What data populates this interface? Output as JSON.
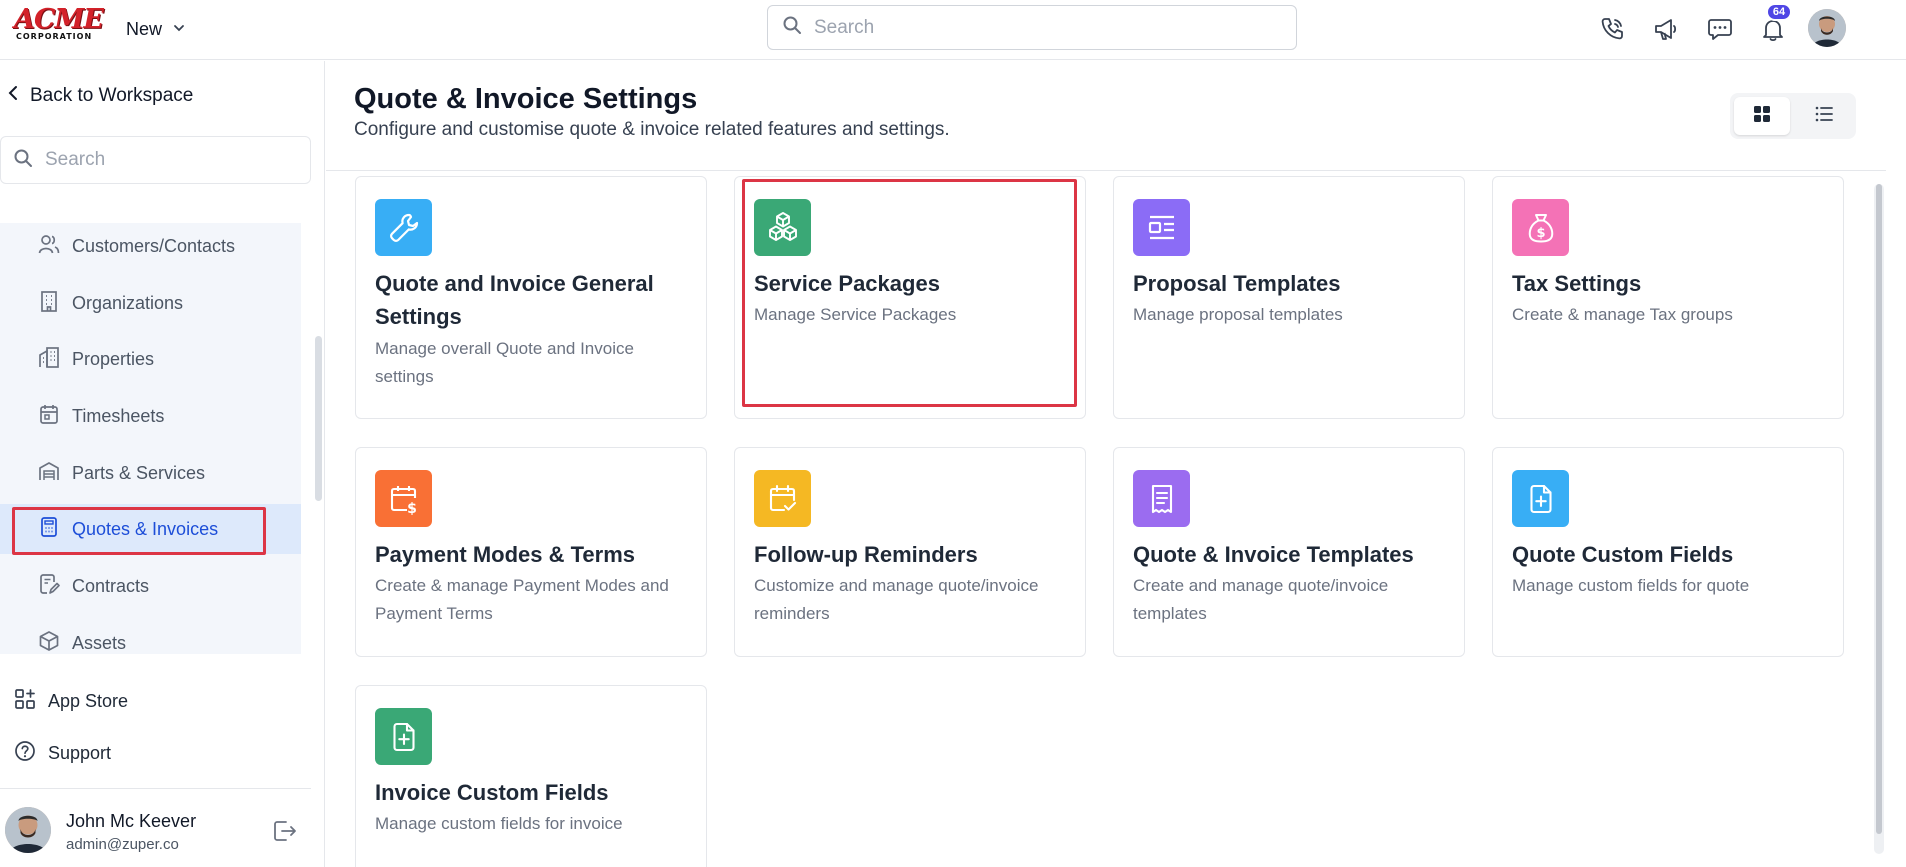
{
  "brand": {
    "logo_main": "ACME",
    "logo_sub": "CORPORATION"
  },
  "topbar": {
    "new_label": "New",
    "search_placeholder": "Search",
    "notification_count": "64",
    "icons": [
      "phone-icon",
      "megaphone-icon",
      "chat-icon",
      "bell-icon"
    ]
  },
  "sidebar": {
    "back_label": "Back to Workspace",
    "search_placeholder": "Search",
    "items": [
      {
        "label": "Customers/Contacts",
        "icon": "users-icon"
      },
      {
        "label": "Organizations",
        "icon": "building-icon"
      },
      {
        "label": "Properties",
        "icon": "properties-icon"
      },
      {
        "label": "Timesheets",
        "icon": "calendar-icon"
      },
      {
        "label": "Parts & Services",
        "icon": "warehouse-icon"
      },
      {
        "label": "Quotes & Invoices",
        "icon": "calculator-icon",
        "active": true
      },
      {
        "label": "Contracts",
        "icon": "contract-icon"
      },
      {
        "label": "Assets",
        "icon": "cube-icon"
      }
    ],
    "app_store_label": "App Store",
    "support_label": "Support",
    "user": {
      "name": "John Mc Keever",
      "email": "admin@zuper.co"
    }
  },
  "header": {
    "title": "Quote & Invoice Settings",
    "subtitle": "Configure and customise quote & invoice related features and settings."
  },
  "cards": [
    {
      "title": "Quote and Invoice General Settings",
      "desc": "Manage overall Quote and Invoice settings",
      "icon": "wrench-icon",
      "color": "#38aef5"
    },
    {
      "title": "Service Packages",
      "desc": "Manage Service Packages",
      "icon": "boxes-icon",
      "color": "#3aa876",
      "highlighted": true
    },
    {
      "title": "Proposal Templates",
      "desc": "Manage proposal templates",
      "icon": "layout-icon",
      "color": "#8b6cf6"
    },
    {
      "title": "Tax Settings",
      "desc": "Create & manage Tax groups",
      "icon": "money-bag-icon",
      "color": "#f472b6"
    },
    {
      "title": "Payment Modes & Terms",
      "desc": "Create & manage Payment Modes and Payment Terms",
      "icon": "calendar-dollar-icon",
      "color": "#f97035"
    },
    {
      "title": "Follow-up Reminders",
      "desc": "Customize and manage quote/invoice reminders",
      "icon": "calendar-check-icon",
      "color": "#f5b823"
    },
    {
      "title": "Quote & Invoice Templates",
      "desc": "Create and manage quote/invoice templates",
      "icon": "receipt-icon",
      "color": "#9b6cf0"
    },
    {
      "title": "Quote Custom Fields",
      "desc": "Manage custom fields for quote",
      "icon": "file-plus-icon",
      "color": "#38aef5"
    },
    {
      "title": "Invoice Custom Fields",
      "desc": "Manage custom fields for invoice",
      "icon": "file-plus-icon",
      "color": "#3aa876"
    }
  ]
}
